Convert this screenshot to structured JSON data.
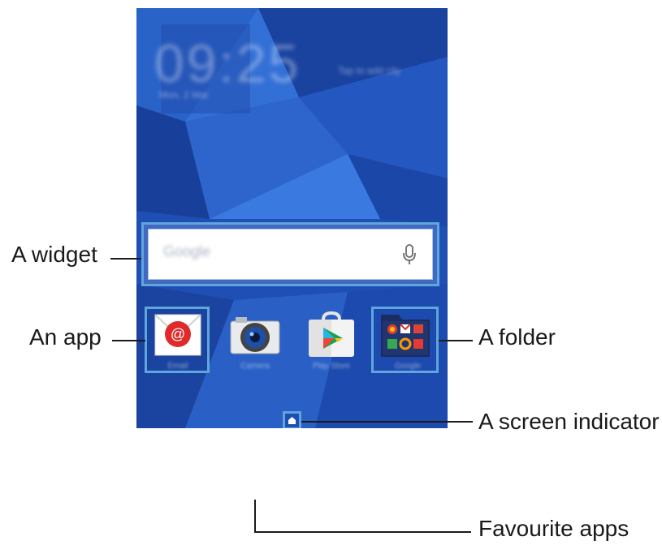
{
  "status": {
    "clock": "09:25",
    "date": "Mon, 2 Mar",
    "weather": "Tap to add city"
  },
  "widget": {
    "search_text": "Google",
    "icon": "mic-icon"
  },
  "apps": [
    {
      "label": "Email",
      "icon": "email-icon"
    },
    {
      "label": "Camera",
      "icon": "camera-icon"
    },
    {
      "label": "Play Store",
      "icon": "play-store-icon"
    },
    {
      "label": "Google",
      "icon": "folder-icon"
    }
  ],
  "favourites": [
    {
      "icon": "phone-icon"
    },
    {
      "icon": "contacts-icon"
    },
    {
      "icon": "messages-icon"
    }
  ],
  "apps_button_icon": "apps-grid-icon",
  "callouts": {
    "widget": "A widget",
    "app": "An app",
    "folder": "A folder",
    "screen_indicator": "A screen indicator",
    "favourite_apps": "Favourite apps"
  },
  "colors": {
    "frame": "#5ea6db",
    "background": "#1f4fb4"
  }
}
